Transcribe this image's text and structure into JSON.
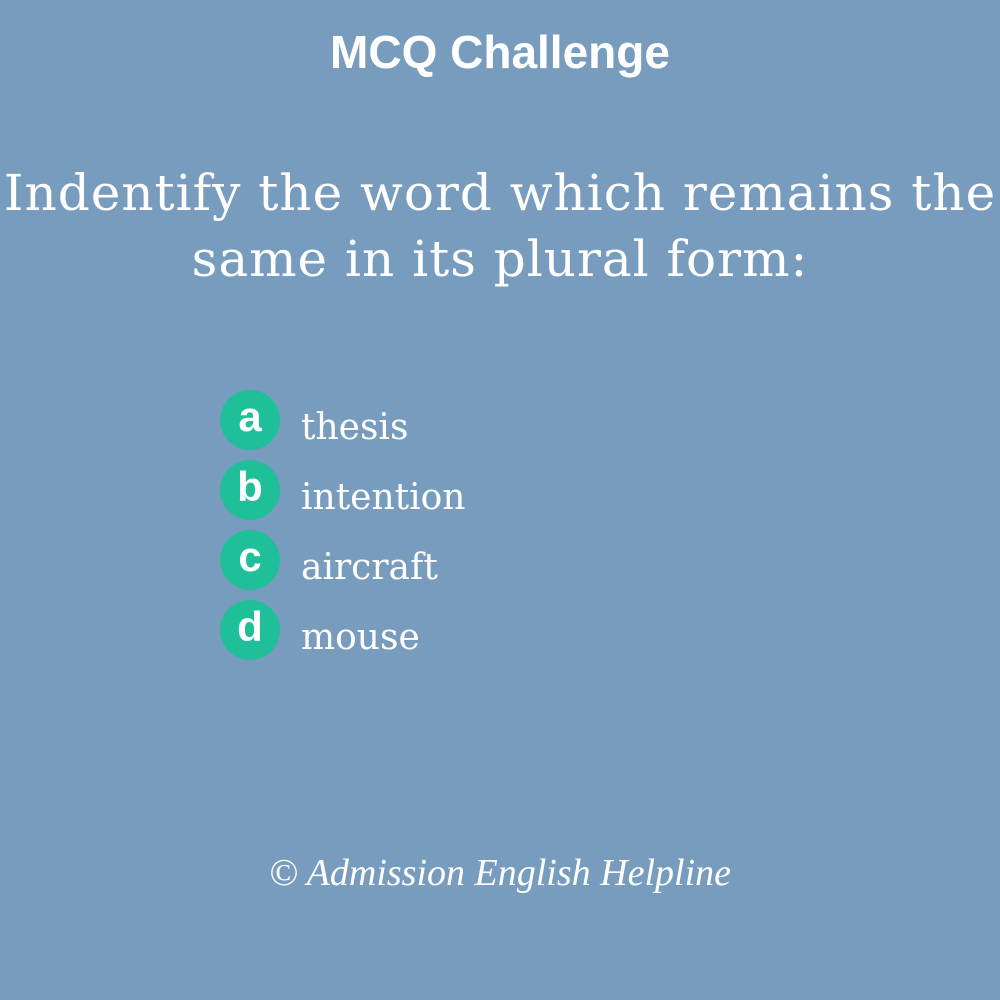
{
  "title": "MCQ Challenge",
  "question": {
    "line1": "Indentify the word which remains the",
    "line2": "same in its plural form:"
  },
  "options": [
    {
      "letter": "a",
      "text": "thesis"
    },
    {
      "letter": "b",
      "text": "intention"
    },
    {
      "letter": "c",
      "text": "aircraft"
    },
    {
      "letter": "d",
      "text": "mouse"
    }
  ],
  "footer": "© Admission English Helpline",
  "colors": {
    "background": "#789cbd",
    "badge": "#1fbf9a",
    "text": "#ffffff"
  }
}
